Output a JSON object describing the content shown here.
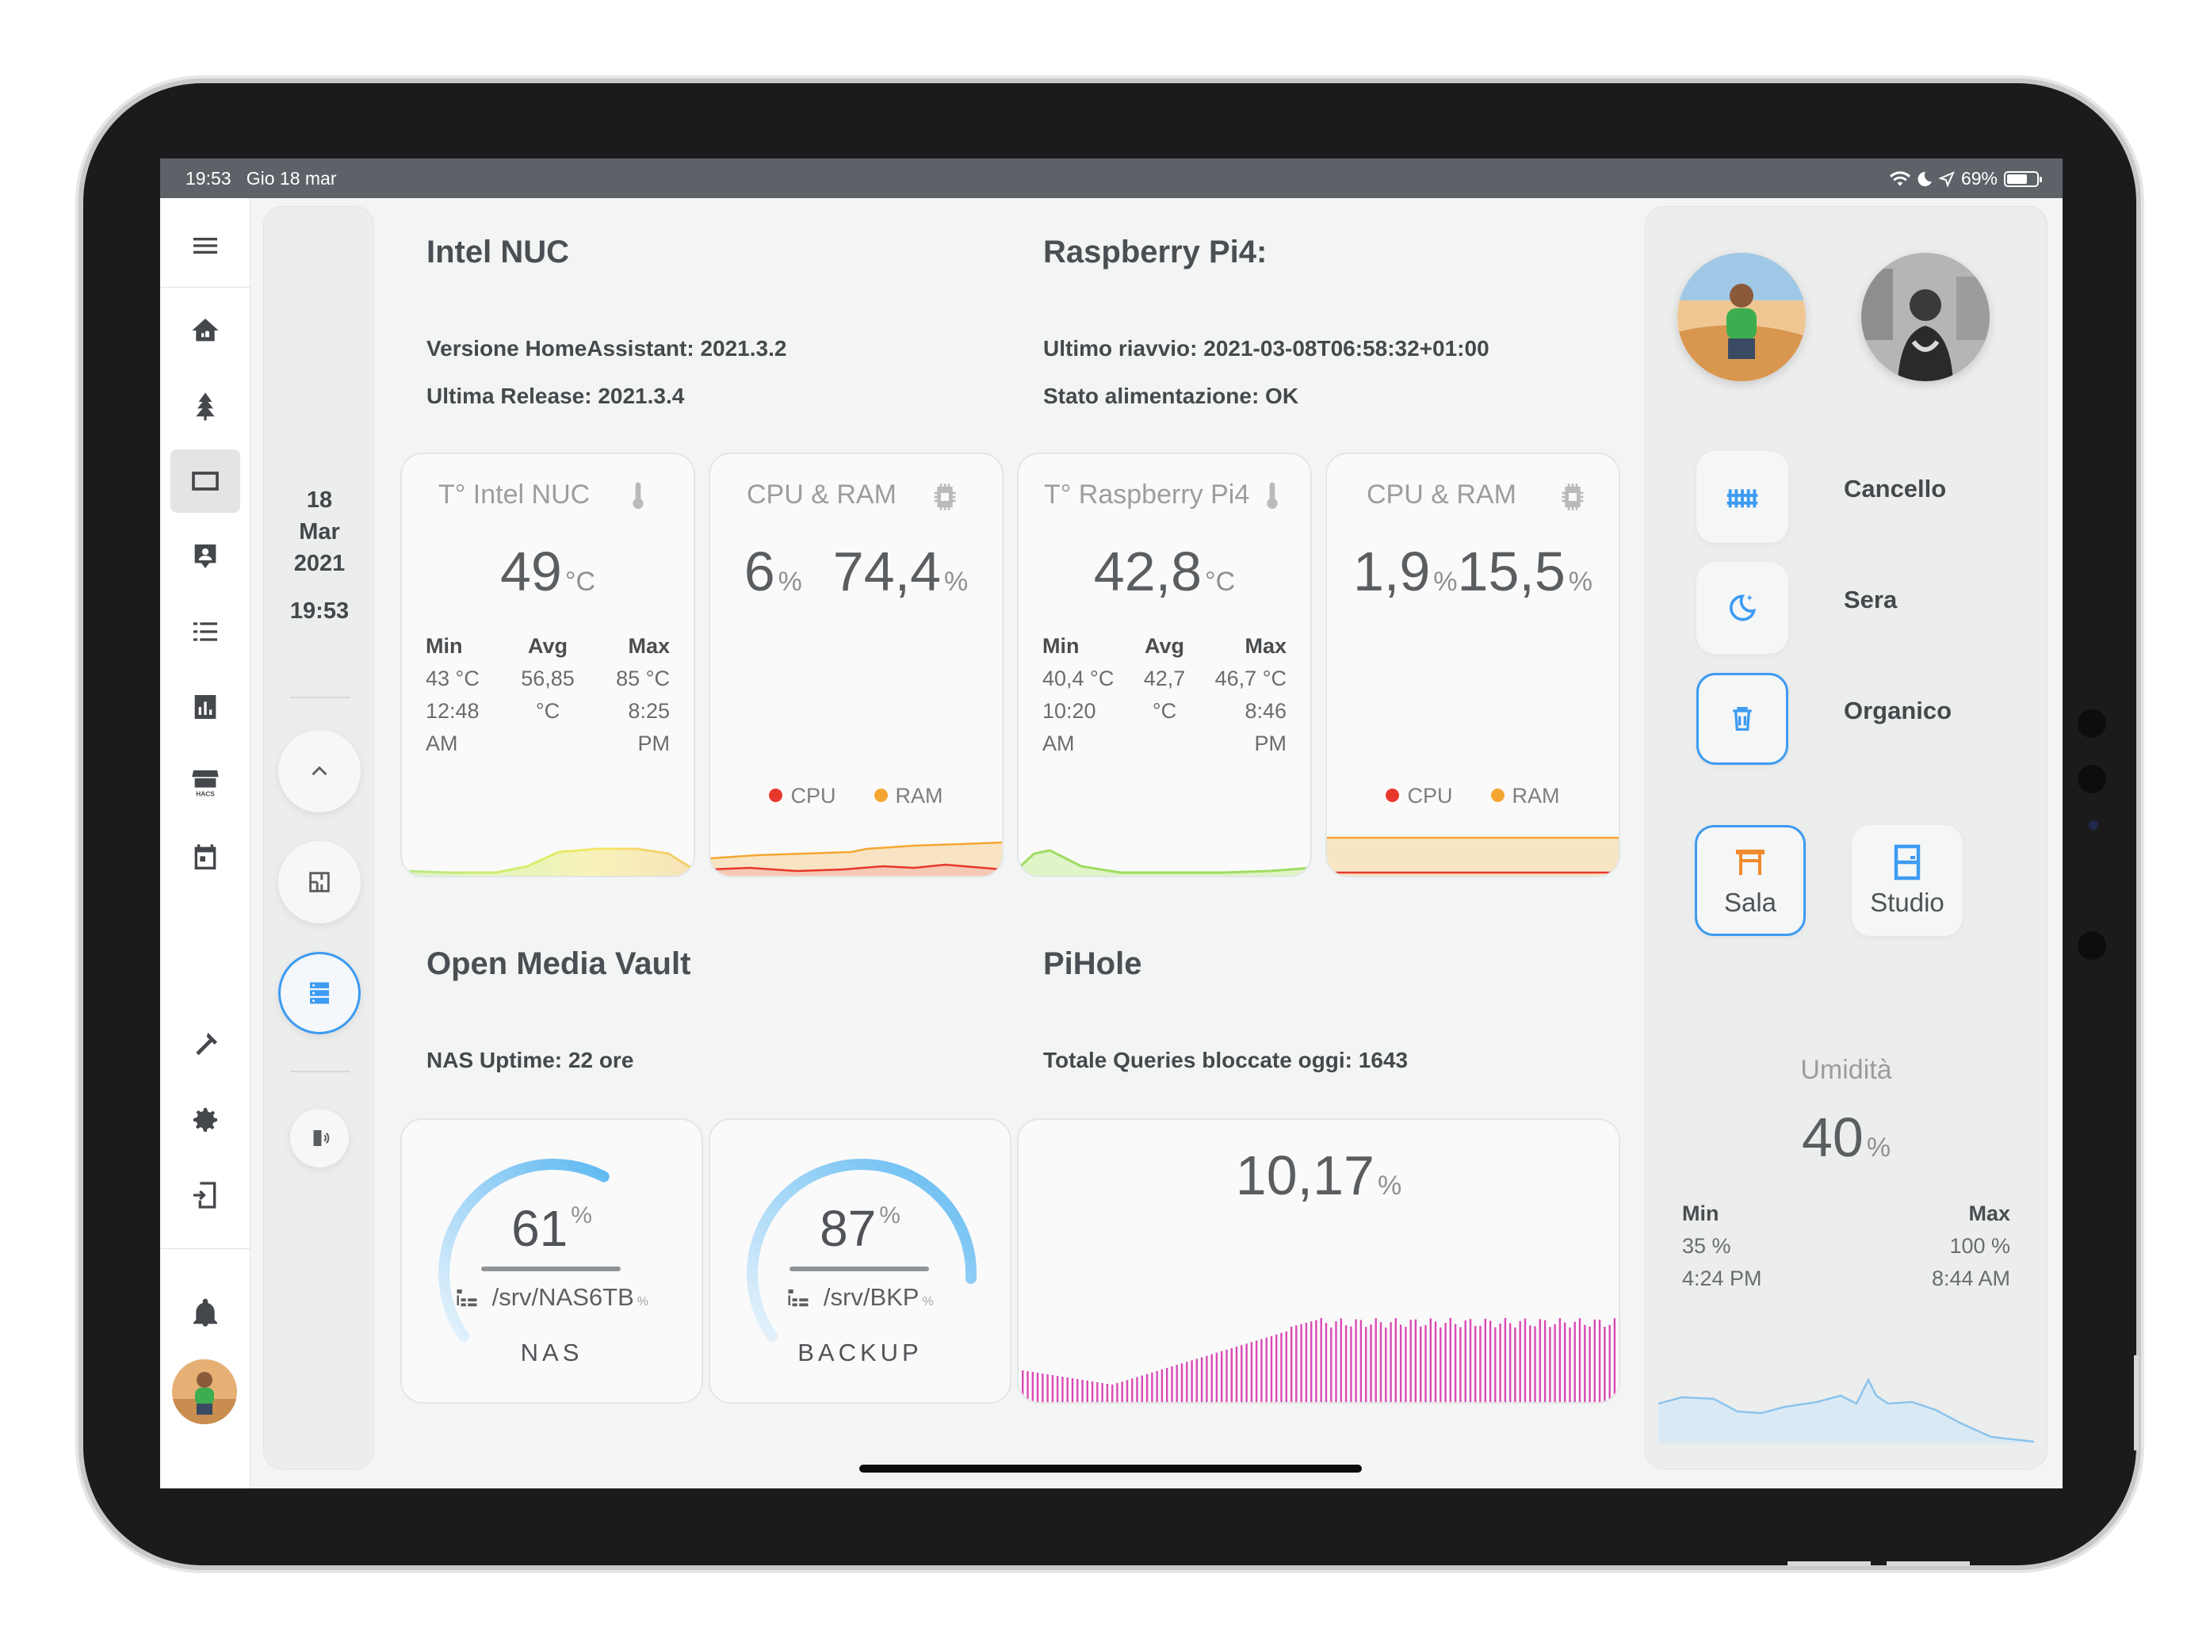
{
  "status_bar": {
    "time": "19:53",
    "date": "Gio 18 mar",
    "battery": "69%",
    "battery_level": 0.69
  },
  "sidebar": {
    "items": [
      "home-cloud-icon",
      "tree-icon",
      "tablet-icon",
      "account-box-icon",
      "list-icon",
      "chart-bar-icon",
      "hacs-store-icon",
      "calendar-icon",
      "hammer-icon",
      "cog-icon",
      "tablet-import-icon",
      "bell-icon"
    ],
    "hacs_label": "HACS"
  },
  "date_column": {
    "day": "18",
    "month": "Mar",
    "year": "2021",
    "time": "19:53"
  },
  "nuc": {
    "title": "Intel NUC",
    "version": "Versione HomeAssistant: 2021.3.2",
    "release": "Ultima Release: 2021.3.4"
  },
  "rpi": {
    "title": "Raspberry Pi4:",
    "reboot": "Ultimo riavvio: 2021-03-08T06:58:32+01:00",
    "power": "Stato alimentazione: OK"
  },
  "cards": {
    "nuc_temp": {
      "title": "T° Intel NUC",
      "value": "49",
      "unit": "°C",
      "min_label": "Min",
      "min": "43 °C",
      "min_time": "12:48",
      "min_ampm": "AM",
      "avg_label": "Avg",
      "avg": "56,85",
      "avg_unit": "°C",
      "max_label": "Max",
      "max": "85 °C",
      "max_time": "8:25",
      "max_ampm": "PM"
    },
    "nuc_cpu": {
      "title": "CPU & RAM",
      "cpu_value": "6",
      "cpu_unit": "%",
      "ram_value": "74,4",
      "ram_unit": "%",
      "legend_cpu": "CPU",
      "legend_ram": "RAM"
    },
    "rpi_temp": {
      "title": "T° Raspberry Pi4",
      "value": "42,8",
      "unit": "°C",
      "min_label": "Min",
      "min": "40,4 °C",
      "min_time": "10:20",
      "min_ampm": "AM",
      "avg_label": "Avg",
      "avg": "42,7",
      "avg_unit": "°C",
      "max_label": "Max",
      "max": "46,7 °C",
      "max_time": "8:46",
      "max_ampm": "PM"
    },
    "rpi_cpu": {
      "title": "CPU & RAM",
      "cpu_value": "1,9",
      "cpu_unit": "%",
      "ram_value": "15,5",
      "ram_unit": "%",
      "legend_cpu": "CPU",
      "legend_ram": "RAM"
    }
  },
  "omv": {
    "title": "Open Media Vault",
    "uptime": "NAS Uptime: 22 ore"
  },
  "pihole": {
    "title": "PiHole",
    "blocked": "Totale Queries bloccate oggi: 1643",
    "percent": "10,17",
    "unit": "%"
  },
  "gauges": {
    "nas": {
      "value": "61",
      "unit": "%",
      "path": "/srv/NAS6TB",
      "path_unit": "%",
      "label": "NAS",
      "level": 0.61
    },
    "backup": {
      "value": "87",
      "unit": "%",
      "path": "/srv/BKP",
      "path_unit": "%",
      "label": "BACKUP",
      "level": 0.87
    }
  },
  "right_panel": {
    "scenes": [
      {
        "label": "Cancello",
        "icon": "gate-icon"
      },
      {
        "label": "Sera",
        "icon": "weather-night-icon"
      },
      {
        "label": "Organico",
        "icon": "trash-can-icon"
      }
    ],
    "rooms": [
      {
        "label": "Sala",
        "icon": "sofa-icon"
      },
      {
        "label": "Studio",
        "icon": "door-icon"
      }
    ],
    "humidity": {
      "title": "Umidità",
      "value": "40",
      "unit": "%",
      "min_label": "Min",
      "min": "35 %",
      "min_time": "4:24 PM",
      "max_label": "Max",
      "max": "100 %",
      "max_time": "8:44 AM"
    }
  },
  "colors": {
    "accent": "#3d9bf2",
    "cpu": "#e8372b",
    "ram": "#f5a631",
    "pihole_bars": "#d94ab5"
  }
}
